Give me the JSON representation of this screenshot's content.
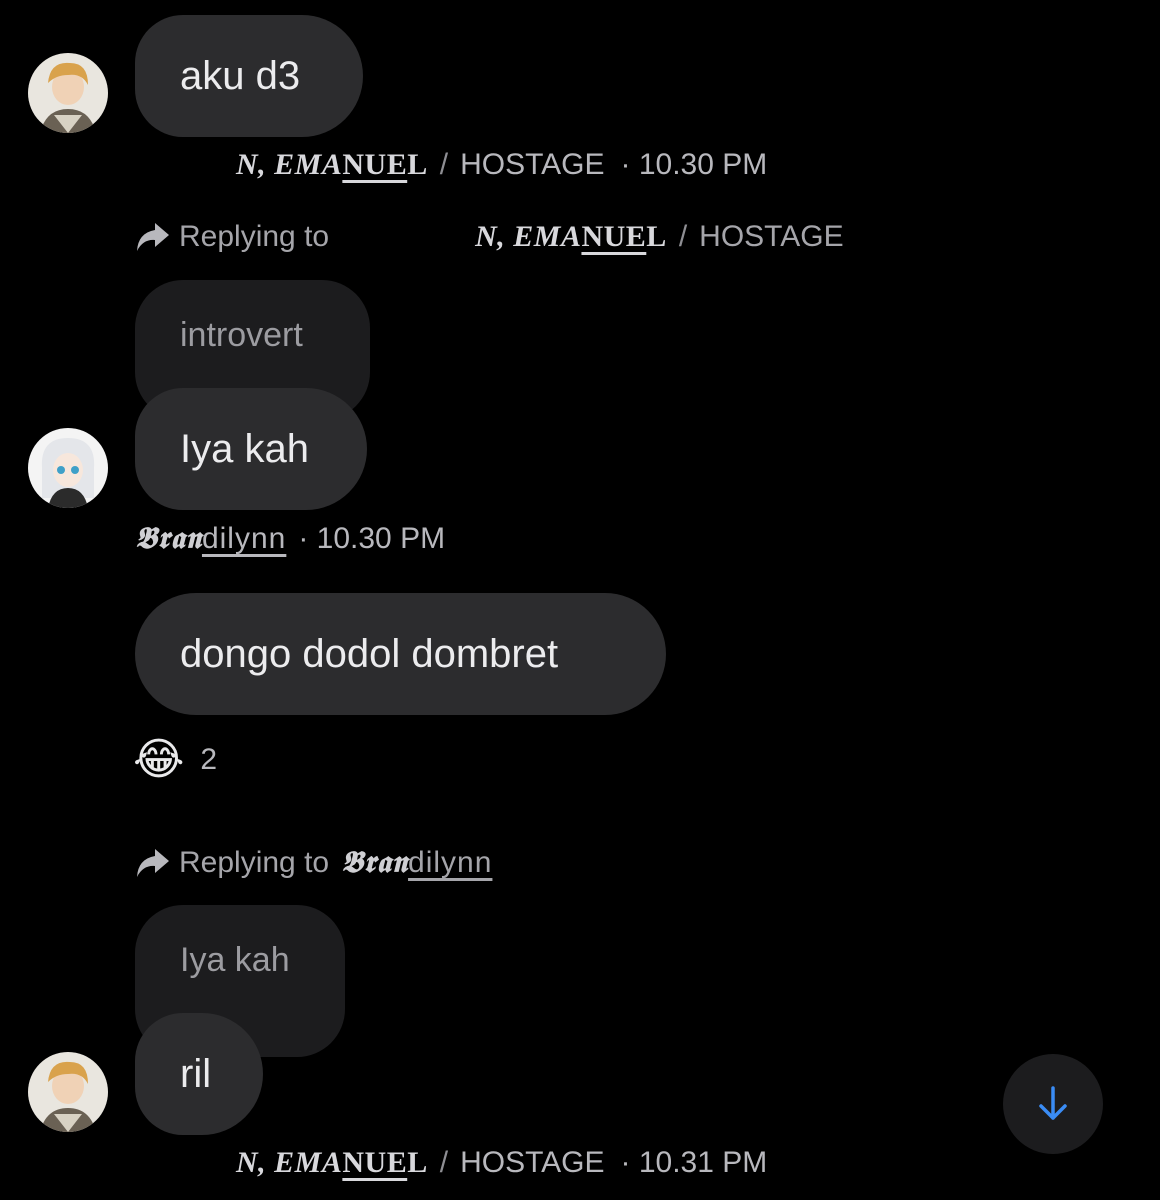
{
  "messages": [
    {
      "text": "aku d3"
    },
    {
      "reply_label": "Replying to",
      "reply_name_a": "N, EMA",
      "reply_name_b": "NUE",
      "reply_name_c": "L",
      "reply_suffix": "HOSTAGE",
      "quoted": "introvert",
      "text": "Iya kah"
    },
    {
      "text": "dongo dodol dombret"
    },
    {
      "reply_label": "Replying to",
      "reply_name_a": "𝕭𝖗𝖆𝖓",
      "reply_name_b": "dilynn",
      "quoted": "Iya kah",
      "text": "ril"
    }
  ],
  "meta1": {
    "name_a": "N, EMA",
    "name_b": "NUE",
    "name_c": "L",
    "slash": "/",
    "suffix": "HOSTAGE",
    "time": "· 10.30 PM"
  },
  "meta2": {
    "name_a": "𝕭𝖗𝖆𝖓",
    "name_b": "dilynn",
    "time": "· 10.30 PM"
  },
  "meta3": {
    "name_a": "N, EMA",
    "name_b": "NUE",
    "name_c": "L",
    "slash": "/",
    "suffix": "HOSTAGE",
    "time": "· 10.31 PM"
  },
  "reaction": {
    "emoji": "😂",
    "count": "2"
  },
  "icons": {
    "reply": "reply-arrow-icon",
    "scroll": "arrow-down-icon"
  },
  "colors": {
    "background": "#000000",
    "bubble": "#2c2c2e",
    "quote": "#1c1c1e",
    "accent": "#3a8cf5"
  }
}
